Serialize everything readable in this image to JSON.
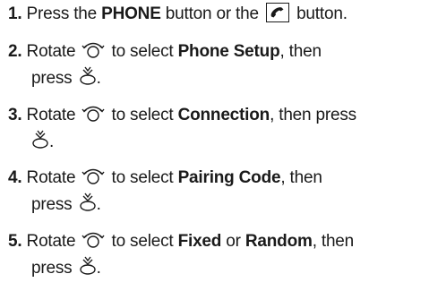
{
  "icons": {
    "selector_dial": "selector-knob-rotate-icon",
    "selector_press": "selector-knob-press-icon",
    "phone_button": "phone-handset-icon"
  },
  "steps": [
    {
      "number": "1.",
      "pre": "Press the",
      "bold1": "PHONE",
      "mid": "button or the",
      "post": "button."
    },
    {
      "number": "2.",
      "pre": "Rotate",
      "mid": "to select",
      "bold1": "Phone Setup",
      "post": ", then",
      "line2": "press",
      "end": "."
    },
    {
      "number": "3.",
      "pre": "Rotate",
      "mid": "to select",
      "bold1": "Connection",
      "post": ", then press",
      "end": "."
    },
    {
      "number": "4.",
      "pre": "Rotate",
      "mid": "to select",
      "bold1": "Pairing Code",
      "post": ", then",
      "line2": "press",
      "end": "."
    },
    {
      "number": "5.",
      "pre": "Rotate",
      "mid": "to select",
      "bold1": "Fixed",
      "or": "or",
      "bold2": "Random",
      "post": ", then",
      "line2": "press",
      "end": "."
    }
  ]
}
